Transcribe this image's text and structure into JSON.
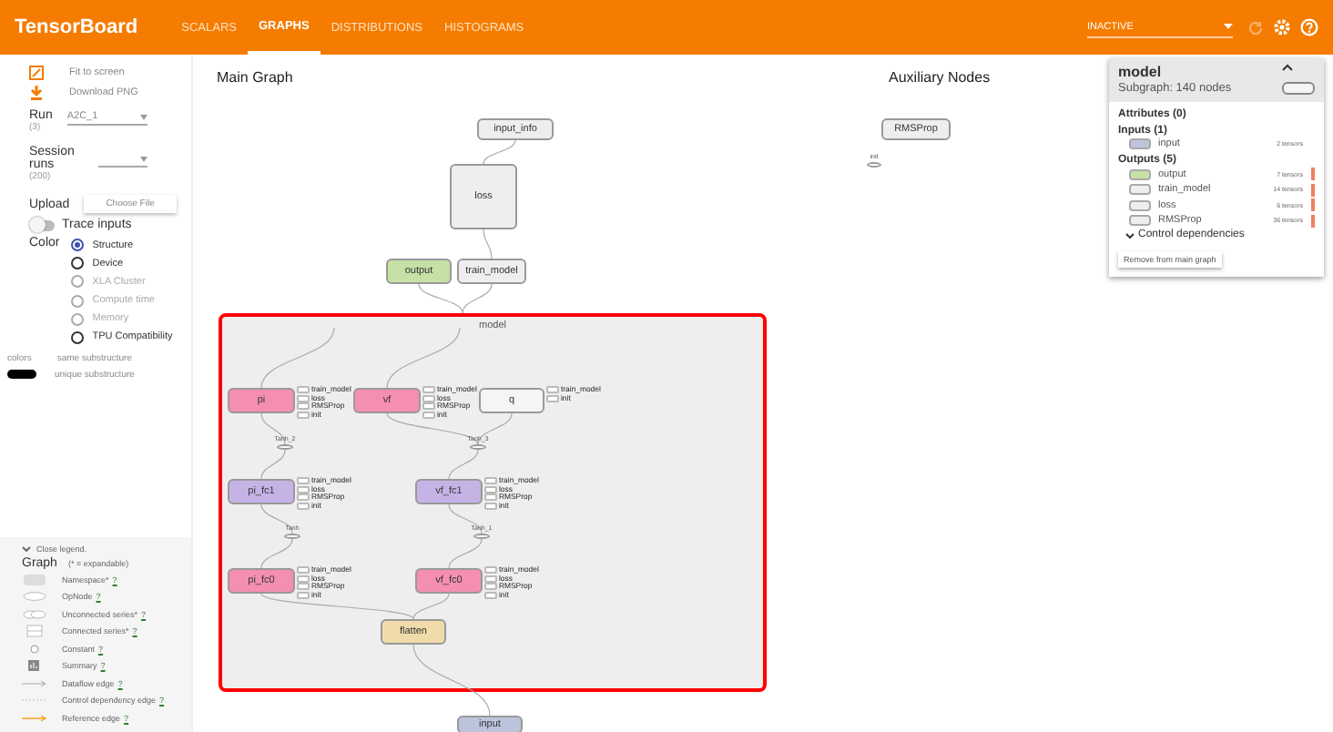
{
  "header": {
    "title": "TensorBoard",
    "tabs": [
      {
        "label": "SCALARS",
        "selected": false
      },
      {
        "label": "GRAPHS",
        "selected": true
      },
      {
        "label": "DISTRIBUTIONS",
        "selected": false
      },
      {
        "label": "HISTOGRAMS",
        "selected": false
      }
    ],
    "status": "INACTIVE",
    "refresh_disabled": true
  },
  "sidebar": {
    "actions": [
      {
        "kind": "fit",
        "label": "Fit to screen"
      },
      {
        "kind": "download",
        "label": "Download PNG"
      }
    ],
    "run": {
      "label": "Run",
      "count": "(3)",
      "value": "A2C_1"
    },
    "session": {
      "label": "Session runs",
      "count": "(200)"
    },
    "upload": {
      "label": "Upload",
      "button": "Choose File"
    },
    "trace": {
      "label": "Trace inputs",
      "on": false
    },
    "color": {
      "label": "Color",
      "options": [
        {
          "label": "Structure",
          "selected": true,
          "disabled": false
        },
        {
          "label": "Device",
          "selected": false,
          "disabled": false
        },
        {
          "label": "XLA Cluster",
          "selected": false,
          "disabled": true
        },
        {
          "label": "Compute time",
          "selected": false,
          "disabled": true
        },
        {
          "label": "Memory",
          "selected": false,
          "disabled": true
        },
        {
          "label": "TPU Compatibility",
          "selected": false,
          "disabled": false
        }
      ]
    },
    "colors_legend": {
      "label": "colors",
      "same": "same substructure",
      "unique": "unique substructure"
    }
  },
  "legend": {
    "toggle": "Close legend.",
    "title": "Graph",
    "note": "(* = expandable)",
    "items": [
      {
        "kind": "namespace",
        "label": "Namespace*",
        "help": "?"
      },
      {
        "kind": "opnode",
        "label": "OpNode",
        "help": "?"
      },
      {
        "kind": "unconnected",
        "label": "Unconnected series*",
        "help": "?"
      },
      {
        "kind": "connected",
        "label": "Connected series*",
        "help": "?"
      },
      {
        "kind": "constant",
        "label": "Constant",
        "help": "?"
      },
      {
        "kind": "summary",
        "label": "Summary",
        "help": "?"
      },
      {
        "kind": "dataflow",
        "label": "Dataflow edge",
        "help": "?"
      },
      {
        "kind": "control",
        "label": "Control dependency edge",
        "help": "?"
      },
      {
        "kind": "reference",
        "label": "Reference edge",
        "help": "?"
      }
    ]
  },
  "main_graph": {
    "title": "Main Graph",
    "namespace": {
      "label": "model",
      "selected": true
    },
    "nodes": [
      {
        "kind": "op",
        "label": "input_info",
        "color": "#eeeeee"
      },
      {
        "kind": "op",
        "label": "loss",
        "color": "#eeeeee"
      },
      {
        "kind": "op",
        "label": "output",
        "color": "#c5e1a5"
      },
      {
        "kind": "op",
        "label": "train_model",
        "color": "#eeeeee"
      },
      {
        "kind": "op",
        "label": "pi",
        "color": "#f48fb1",
        "aux": [
          "train_model",
          "loss",
          "RMSProp",
          "init"
        ]
      },
      {
        "kind": "op",
        "label": "vf",
        "color": "#f48fb1",
        "aux": [
          "train_model",
          "loss",
          "RMSProp",
          "init"
        ]
      },
      {
        "kind": "op",
        "label": "q",
        "color": "#f5f5f5",
        "aux": [
          "train_model",
          "init"
        ]
      },
      {
        "kind": "series",
        "label": "Tanh_2"
      },
      {
        "kind": "series",
        "label": "Tanh_3"
      },
      {
        "kind": "op",
        "label": "pi_fc1",
        "color": "#c5b3e6",
        "aux": [
          "train_model",
          "loss",
          "RMSProp",
          "init"
        ]
      },
      {
        "kind": "op",
        "label": "vf_fc1",
        "color": "#c5b3e6",
        "aux": [
          "train_model",
          "loss",
          "RMSProp",
          "init"
        ]
      },
      {
        "kind": "series",
        "label": "Tanh"
      },
      {
        "kind": "series",
        "label": "Tanh_1"
      },
      {
        "kind": "op",
        "label": "pi_fc0",
        "color": "#f48fb1",
        "aux": [
          "train_model",
          "loss",
          "RMSProp",
          "init"
        ]
      },
      {
        "kind": "op",
        "label": "vf_fc0",
        "color": "#f48fb1",
        "aux": [
          "train_model",
          "loss",
          "RMSProp",
          "init"
        ]
      },
      {
        "kind": "op",
        "label": "flatten",
        "color": "#f0dcaa"
      },
      {
        "kind": "op",
        "label": "input",
        "color": "#bcc4dc"
      }
    ]
  },
  "auxiliary": {
    "title": "Auxiliary Nodes",
    "nodes": [
      {
        "kind": "op",
        "label": "RMSProp",
        "color": "#eeeeee"
      },
      {
        "kind": "series",
        "label": "init"
      }
    ]
  },
  "info_card": {
    "title": "model",
    "subtitle": "Subgraph: 140 nodes",
    "attributes": "Attributes (0)",
    "inputs_title": "Inputs (1)",
    "inputs": [
      {
        "name": "input",
        "count": "2 tensors",
        "color": "#bcc4dc"
      }
    ],
    "outputs_title": "Outputs (5)",
    "outputs": [
      {
        "name": "output",
        "count": "7 tensors",
        "color": "#c5e1a5"
      },
      {
        "name": "train_model",
        "count": "14 tensors",
        "color": "#eeeeee"
      },
      {
        "name": "loss",
        "count": "6 tensors",
        "color": "#eeeeee"
      },
      {
        "name": "RMSProp",
        "count": "36 tensors",
        "color": "#eeeeee"
      }
    ],
    "control": "Control dependencies",
    "button": "Remove from main graph"
  }
}
